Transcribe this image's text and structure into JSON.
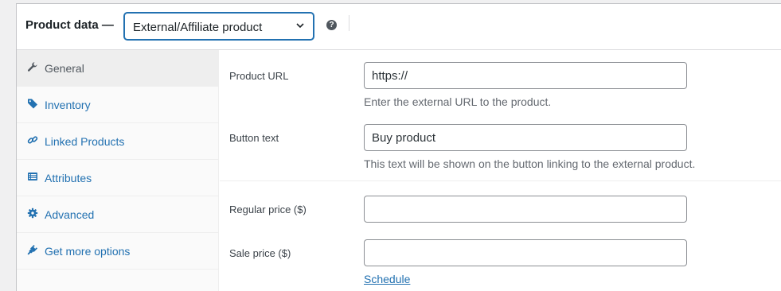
{
  "header": {
    "title": "Product data",
    "dash": "—",
    "product_type": "External/Affiliate product",
    "help_icon": "question-circle-icon"
  },
  "tabs": [
    {
      "label": "General",
      "icon": "wrench-icon",
      "active": true
    },
    {
      "label": "Inventory",
      "icon": "tag-icon",
      "active": false
    },
    {
      "label": "Linked Products",
      "icon": "link-icon",
      "active": false
    },
    {
      "label": "Attributes",
      "icon": "list-icon",
      "active": false
    },
    {
      "label": "Advanced",
      "icon": "gear-icon",
      "active": false
    },
    {
      "label": "Get more options",
      "icon": "plugin-icon",
      "active": false
    }
  ],
  "general": {
    "product_url": {
      "label": "Product URL",
      "value": "https://",
      "description": "Enter the external URL to the product."
    },
    "button_text": {
      "label": "Button text",
      "value": "Buy product",
      "description": "This text will be shown on the button linking to the external product."
    },
    "regular_price": {
      "label": "Regular price ($)",
      "value": ""
    },
    "sale_price": {
      "label": "Sale price ($)",
      "value": ""
    },
    "schedule_link": "Schedule"
  },
  "colors": {
    "accent": "#2271b1",
    "active_tab_bg": "#eeeeee",
    "tab_bg": "#fafafa"
  }
}
